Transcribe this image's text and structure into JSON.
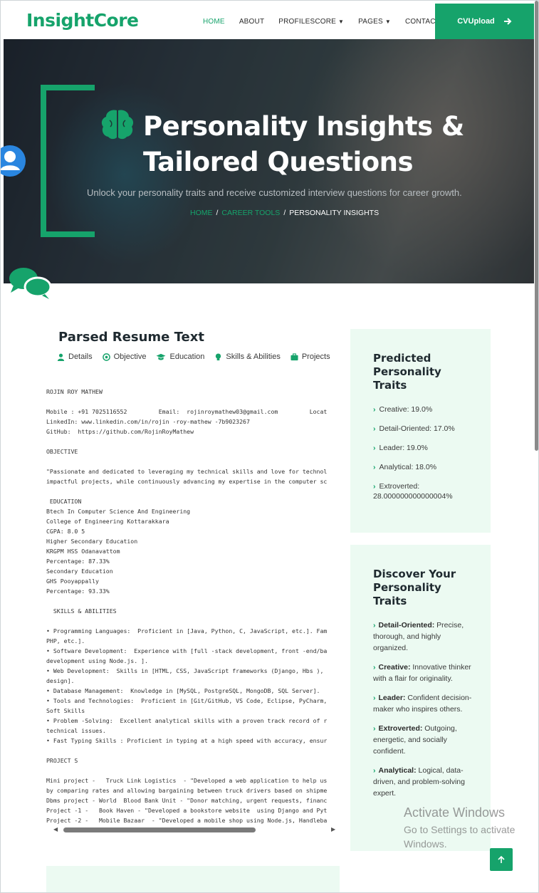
{
  "nav": {
    "logo": "InsightCore",
    "items": [
      {
        "label": "HOME",
        "dropdown": false,
        "active": true
      },
      {
        "label": "ABOUT",
        "dropdown": false,
        "active": false
      },
      {
        "label": "PROFILESCORE",
        "dropdown": true,
        "active": false
      },
      {
        "label": "PAGES",
        "dropdown": true,
        "active": false
      },
      {
        "label": "CONTACT",
        "dropdown": false,
        "active": false
      }
    ],
    "cta_label": "CVUpload",
    "cta_icon": "arrow-right-icon"
  },
  "hero": {
    "title": "Personality Insights & Tailored Questions",
    "subtitle": "Unlock your personality traits and receive customized interview questions for career growth.",
    "breadcrumb": {
      "home": "HOME",
      "tools": "CAREER TOOLS",
      "current": "PERSONALITY INSIGHTS",
      "separator": "/"
    }
  },
  "resume_card": {
    "title": "Parsed Resume Text",
    "tabs": [
      {
        "label": "Details",
        "icon": "user-icon"
      },
      {
        "label": "Objective",
        "icon": "target-icon"
      },
      {
        "label": "Education",
        "icon": "graduation-cap-icon"
      },
      {
        "label": "Skills & Abilities",
        "icon": "lightbulb-icon"
      },
      {
        "label": "Projects",
        "icon": "briefcase-icon"
      }
    ],
    "text": "ROJIN ROY MATHEW\n\nMobile : +91 7025116552         Email:  rojinroymathew03@gmail.com         Locat\nLinkedIn: www.linkedin.com/in/rojin -roy-mathew -7b9023267\nGitHub:  https://github.com/RojinRoyMathew\n\nOBJECTIVE\n\n\"Passionate and dedicated to leveraging my technical skills and love for technol\nimpactful projects, while continuously advancing my expertise in the computer sc\n\n EDUCATION\nBtech In Computer Science And Engineering\nCollege of Engineering Kottarakkara\nCGPA: 8.0 5\nHigher Secondary Education\nKRGPM HSS Odanavattom\nPercentage: 87.33%\nSecondary Education\nGHS Pooyappally\nPercentage: 93.33%\n\n  SKILLS & ABILITIES\n\n• Programming Languages:  Proficient in [Java, Python, C, JavaScript, etc.]. Fam\nPHP, etc.].\n• Software Development:  Experience with [full -stack development, front -end/ba\ndevelopment using Node.js. ].\n• Web Development:  Skills in [HTML, CSS, JavaScript frameworks (Django, Hbs ),\ndesign].\n• Database Management:  Knowledge in [MySQL, PostgreSQL, MongoDB, SQL Server].\n• Tools and Technologies:  Proficient in [Git/GitHub, VS Code, Eclipse, PyCharm,\nSoft Skills\n• Problem -Solving:  Excellent analytical skills with a proven track record of r\ntechnical issues.\n• Fast Typing Skills : Proficient in typing at a high speed with accuracy, ensur\n\nPROJECT S\n\nMini project -   Truck Link Logistics  - \"Developed a web application to help us\nby comparing rates and allowing bargaining between truck drivers based on shipme\nDbms project - World  Blood Bank Unit - \"Donor matching, urgent requests, financ\nProject -1 -   Book Haven - \"Developed a bookstore website  using Django and Pyt\nProject -2 -   Mobile Bazaar  - \"Developed a mobile shop using Node.js, Handleba"
  },
  "predicted": {
    "title": "Predicted Personality Traits",
    "traits": [
      {
        "text": "Creative: 19.0%"
      },
      {
        "text": "Detail-Oriented: 17.0%"
      },
      {
        "text": "Leader: 19.0%"
      },
      {
        "text": "Analytical: 18.0%"
      },
      {
        "text": "Extroverted: 28.000000000000004%"
      }
    ]
  },
  "discover": {
    "title": "Discover Your Personality Traits",
    "items": [
      {
        "name": "Detail-Oriented:",
        "desc": " Precise, thorough, and highly organized."
      },
      {
        "name": "Creative:",
        "desc": " Innovative thinker with a flair for originality."
      },
      {
        "name": "Leader:",
        "desc": " Confident decision-maker who inspires others."
      },
      {
        "name": "Extroverted:",
        "desc": " Outgoing, energetic, and socially confident."
      },
      {
        "name": "Analytical:",
        "desc": " Logical, data-driven, and problem-solving expert."
      }
    ]
  },
  "watermark": {
    "line1": "Activate Windows",
    "line2": "Go to Settings to activate Windows."
  },
  "colors": {
    "accent": "#16a36b",
    "panel": "#ecfaf2"
  }
}
